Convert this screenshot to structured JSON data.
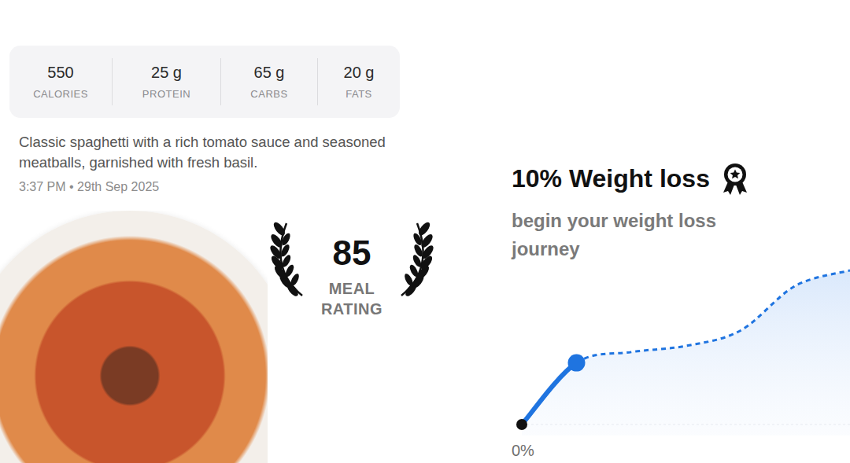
{
  "nutrition": [
    {
      "value": "550",
      "label": "CALORIES"
    },
    {
      "value": "25 g",
      "label": "PROTEIN"
    },
    {
      "value": "65 g",
      "label": "CARBS"
    },
    {
      "value": "20 g",
      "label": "FATS"
    }
  ],
  "meal": {
    "description": "Classic spaghetti with a rich tomato sauce and seasoned meatballs, garnished with fresh basil.",
    "timestamp": "3:37 PM • 29th Sep 2025"
  },
  "rating": {
    "value": "85",
    "label": "MEAL RATING"
  },
  "goal": {
    "title": "10% Weight loss",
    "subtitle": "begin your weight loss journey"
  },
  "chart": {
    "axis_label": "0%",
    "points": [
      {
        "value": 0,
        "reached": true
      },
      {
        "value": 4.0,
        "reached": true
      },
      {
        "value": 4.7,
        "reached": false
      },
      {
        "value": 5.1,
        "reached": false
      },
      {
        "value": 6.1,
        "reached": false
      },
      {
        "value": 9.0,
        "reached": false
      },
      {
        "value": 10,
        "reached": false
      }
    ]
  }
}
